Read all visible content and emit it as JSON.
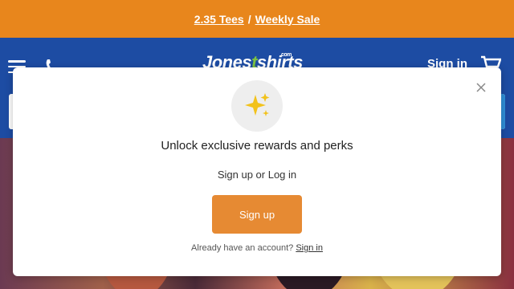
{
  "promo": {
    "part1": "2.35 Tees",
    "separator": "/",
    "part2": "Weekly Sale"
  },
  "header": {
    "logo_main": "Jones",
    "logo_t": "t",
    "logo_rest": "shirts",
    "logo_com": ".com",
    "signin": "Sign in"
  },
  "modal": {
    "title": "Unlock exclusive rewards and perks",
    "subtitle": "Sign up or Log in",
    "signup_button": "Sign up",
    "already_text": "Already have an account?",
    "signin_link": "Sign in"
  },
  "colors": {
    "promo_bg": "#e8861c",
    "header_bg": "#1d4ca3",
    "accent_button": "#e68a33",
    "logo_green": "#7cc242"
  },
  "icons": [
    "hamburger-icon",
    "phone-icon",
    "cart-icon",
    "search-icon",
    "sparkles-icon",
    "close-icon"
  ]
}
